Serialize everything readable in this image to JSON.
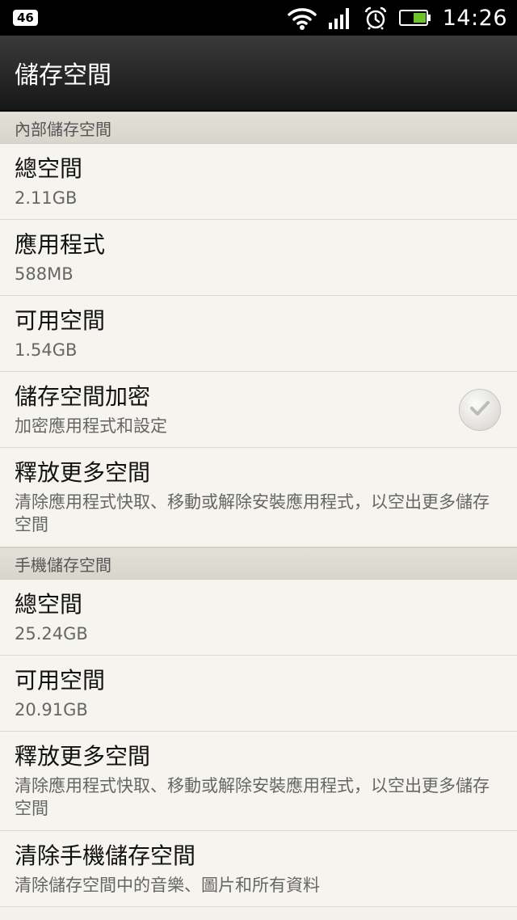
{
  "status_bar": {
    "network_type": "46",
    "time": "14:26",
    "icons": [
      "wifi-icon",
      "signal-icon",
      "alarm-icon",
      "battery-icon"
    ]
  },
  "title_bar": {
    "title": "儲存空間"
  },
  "internal_storage": {
    "header": "內部儲存空間",
    "total": {
      "label": "總空間",
      "value": "2.11GB"
    },
    "apps": {
      "label": "應用程式",
      "value": "588MB"
    },
    "available": {
      "label": "可用空間",
      "value": "1.54GB"
    },
    "encrypt": {
      "label": "儲存空間加密",
      "description": "加密應用程式和設定",
      "checked": false
    },
    "free_up": {
      "label": "釋放更多空間",
      "description": "清除應用程式快取、移動或解除安裝應用程式，以空出更多儲存空間"
    }
  },
  "phone_storage": {
    "header": "手機儲存空間",
    "total": {
      "label": "總空間",
      "value": "25.24GB"
    },
    "available": {
      "label": "可用空間",
      "value": "20.91GB"
    },
    "free_up": {
      "label": "釋放更多空間",
      "description": "清除應用程式快取、移動或解除安裝應用程式，以空出更多儲存空間"
    },
    "erase": {
      "label": "清除手機儲存空間",
      "description": "清除儲存空間中的音樂、圖片和所有資料"
    }
  }
}
